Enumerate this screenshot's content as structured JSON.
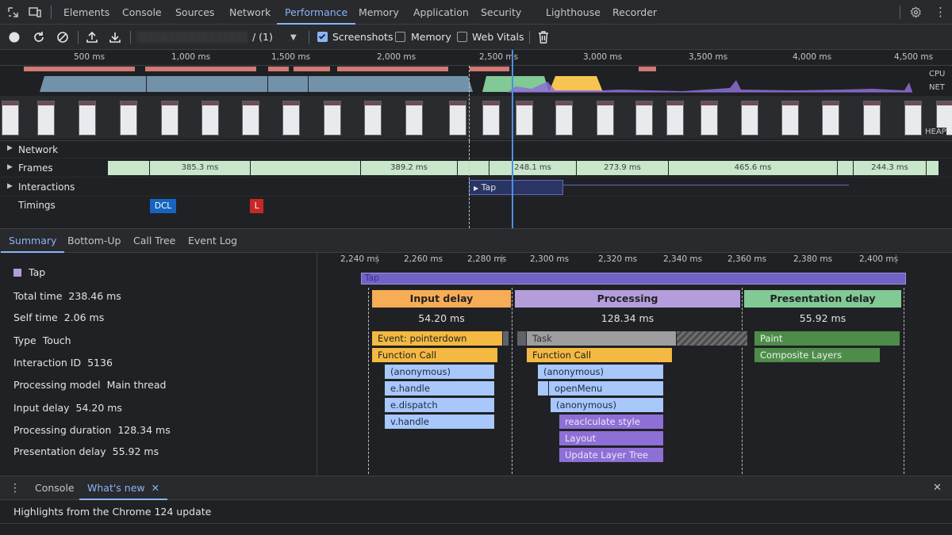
{
  "tabs": [
    "Elements",
    "Console",
    "Sources",
    "Network",
    "Performance",
    "Memory",
    "Application",
    "Security",
    "Lighthouse",
    "Recorder"
  ],
  "active_tab": "Performance",
  "toolbar": {
    "recording_name_masked": "▒▒▒▒▒▒▒▒▒▒▒▒▒▒▒▒▒▒▒▒",
    "recording_index": "/ (1)",
    "screenshots_label": "Screenshots",
    "screenshots_checked": true,
    "memory_label": "Memory",
    "memory_checked": false,
    "web_vitals_label": "Web Vitals",
    "web_vitals_checked": false
  },
  "overview": {
    "ticks": [
      "500 ms",
      "1,000 ms",
      "1,500 ms",
      "2,000 ms",
      "2,500 ms",
      "3,000 ms",
      "3,500 ms",
      "4,000 ms",
      "4,500 ms"
    ],
    "cpu_label": "CPU",
    "net_label": "NET",
    "heap_label": "HEAP"
  },
  "tracks": {
    "network_label": "Network",
    "frames_label": "Frames",
    "interactions_label": "Interactions",
    "timings_label": "Timings",
    "frames": [
      "385.3 ms",
      "389.2 ms",
      "248.1 ms",
      "273.9 ms",
      "465.6 ms",
      "244.3 ms"
    ],
    "interaction_label": "Tap",
    "dcl_label": "DCL",
    "l_label": "L"
  },
  "panel_tabs": [
    "Summary",
    "Bottom-Up",
    "Call Tree",
    "Event Log"
  ],
  "active_panel_tab": "Summary",
  "summary": {
    "title": "Tap",
    "swatch_color": "#b39ddb",
    "rows": [
      {
        "key": "Total time",
        "value": "238.46 ms"
      },
      {
        "key": "Self time",
        "value": "2.06 ms"
      },
      {
        "key": "Type",
        "value": "Touch"
      },
      {
        "key": "Interaction ID",
        "value": "5136"
      },
      {
        "key": "Processing model",
        "value": "Main thread"
      },
      {
        "key": "Input delay",
        "value": "54.20 ms"
      },
      {
        "key": "Processing duration",
        "value": "128.34 ms"
      },
      {
        "key": "Presentation delay",
        "value": "55.92 ms"
      }
    ]
  },
  "detail": {
    "ticks": [
      "2,240 ms",
      "2,260 ms",
      "2,280 ms",
      "2,300 ms",
      "2,320 ms",
      "2,340 ms",
      "2,360 ms",
      "2,380 ms",
      "2,400 ms"
    ],
    "tap_bar_label": "Tap",
    "phases": [
      {
        "name": "Input delay",
        "value": "54.20 ms",
        "color": "#f6ad55"
      },
      {
        "name": "Processing",
        "value": "128.34 ms",
        "color": "#b39ddb"
      },
      {
        "name": "Presentation delay",
        "value": "55.92 ms",
        "color": "#81c995"
      }
    ],
    "input_delay_events": [
      "Event: pointerdown",
      "Function Call",
      "(anonymous)",
      "e.handle",
      "e.dispatch",
      "v.handle"
    ],
    "processing_events": [
      "Task",
      "Function Call",
      "(anonymous)",
      "openMenu",
      "(anonymous)",
      "reaclculate style",
      "Layout",
      "Update Layer Tree"
    ],
    "presentation_events": [
      "Paint",
      "Composite Layers"
    ]
  },
  "drawer": {
    "tabs": [
      "Console",
      "What's new"
    ],
    "active": "What's new",
    "body_text": "Highlights from the Chrome 124 update"
  }
}
